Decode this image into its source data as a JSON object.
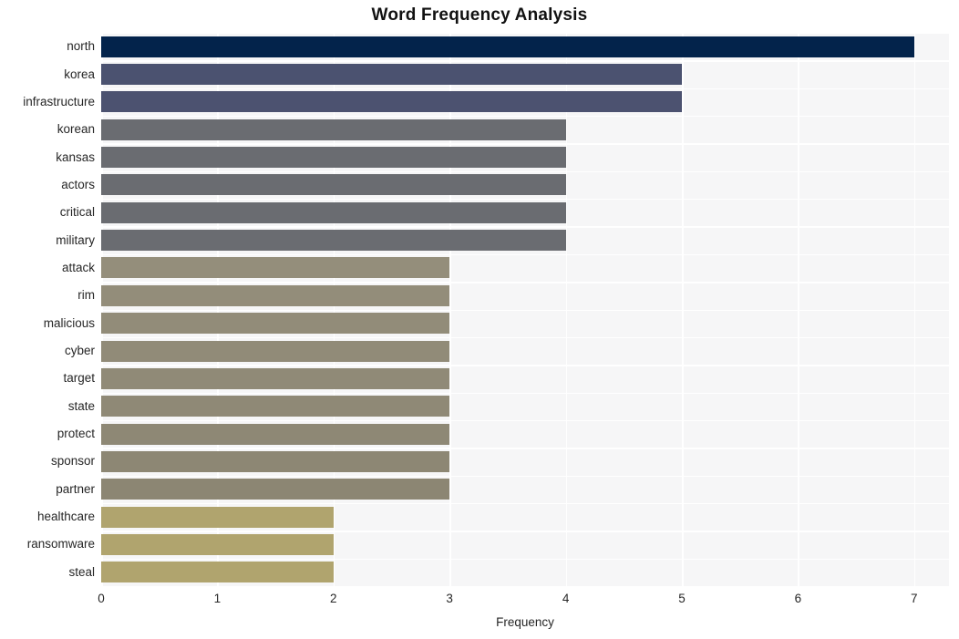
{
  "chart_data": {
    "type": "bar",
    "orientation": "horizontal",
    "title": "Word Frequency Analysis",
    "xlabel": "Frequency",
    "ylabel": "",
    "xlim": [
      0,
      7.3
    ],
    "xticks": [
      0,
      1,
      2,
      3,
      4,
      5,
      6,
      7
    ],
    "xtick_labels": [
      "0",
      "1",
      "2",
      "3",
      "4",
      "5",
      "6",
      "7"
    ],
    "grid": true,
    "legend": null,
    "categories": [
      "north",
      "korea",
      "infrastructure",
      "korean",
      "kansas",
      "actors",
      "critical",
      "military",
      "attack",
      "rim",
      "malicious",
      "cyber",
      "target",
      "state",
      "protect",
      "sponsor",
      "partner",
      "healthcare",
      "ransomware",
      "steal"
    ],
    "values": [
      7,
      5,
      5,
      4,
      4,
      4,
      4,
      4,
      3,
      3,
      3,
      3,
      3,
      3,
      3,
      3,
      3,
      2,
      2,
      2
    ],
    "bar_colors": [
      "#03234b",
      "#4b5270",
      "#4c5270",
      "#6a6c71",
      "#6a6c71",
      "#6a6c71",
      "#6a6c71",
      "#6a6c71",
      "#948e7b",
      "#938d7a",
      "#928c79",
      "#918b78",
      "#908a77",
      "#8f8976",
      "#8e8875",
      "#8d8774",
      "#8c8673",
      "#b0a46e",
      "#b0a46e",
      "#b0a46e"
    ],
    "plot_bgcolor": "#f6f6f7",
    "gridline_color": "#ffffff",
    "text_color": "#262626"
  }
}
